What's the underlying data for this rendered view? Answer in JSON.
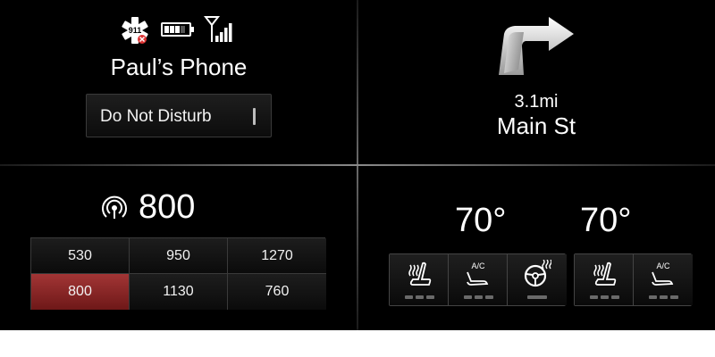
{
  "phone": {
    "emergency_icon_text": "911",
    "battery_cells_filled": 3,
    "battery_cells_total": 5,
    "name": "Paul’s Phone",
    "dnd_label": "Do Not Disturb"
  },
  "navigation": {
    "icon": "turn-right-icon",
    "distance": "3.1mi",
    "street": "Main St"
  },
  "radio": {
    "icon": "radio-broadcast-icon",
    "frequency": "800",
    "presets": [
      "530",
      "950",
      "1270",
      "800",
      "1130",
      "760"
    ],
    "active_preset_index": 3,
    "active_color": "#8e2828"
  },
  "climate": {
    "driver_temp": "70°",
    "passenger_temp": "70°",
    "ac_label": "A/C"
  }
}
